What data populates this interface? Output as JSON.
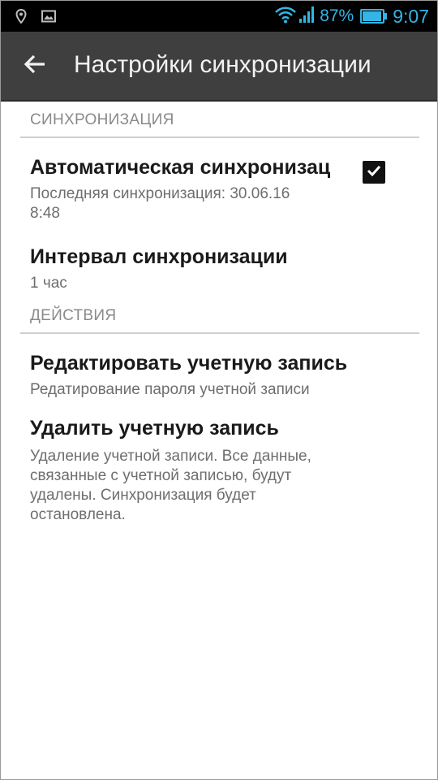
{
  "status_bar": {
    "left_icons": [
      "location-icon",
      "image-icon"
    ],
    "battery_percent_label": "87%",
    "battery_level": 0.87,
    "time": "9:07",
    "accent_color": "#33b5e5"
  },
  "action_bar": {
    "back_icon": "arrow-left-icon",
    "title": "Настройки синхронизации"
  },
  "sections": [
    {
      "header": "СИНХРОНИЗАЦИЯ",
      "items": [
        {
          "title": "Автоматическая синхронизац",
          "summary_line1": "Последняя синхронизация: 30.06.16",
          "summary_line2": "8:48",
          "checked": true
        },
        {
          "title": "Интервал синхронизации",
          "summary": "1 час"
        }
      ]
    },
    {
      "header": "ДЕЙСТВИЯ",
      "items": [
        {
          "title": "Редактировать учетную запись",
          "summary": "Редатирование пароля учетной записи"
        },
        {
          "title": "Удалить учетную запись",
          "summary_lines": [
            "Удаление учетной записи. Все данные,",
            "связанные с учетной записью, будут",
            "удалены. Синхронизация будет",
            "остановлена."
          ]
        }
      ]
    }
  ]
}
